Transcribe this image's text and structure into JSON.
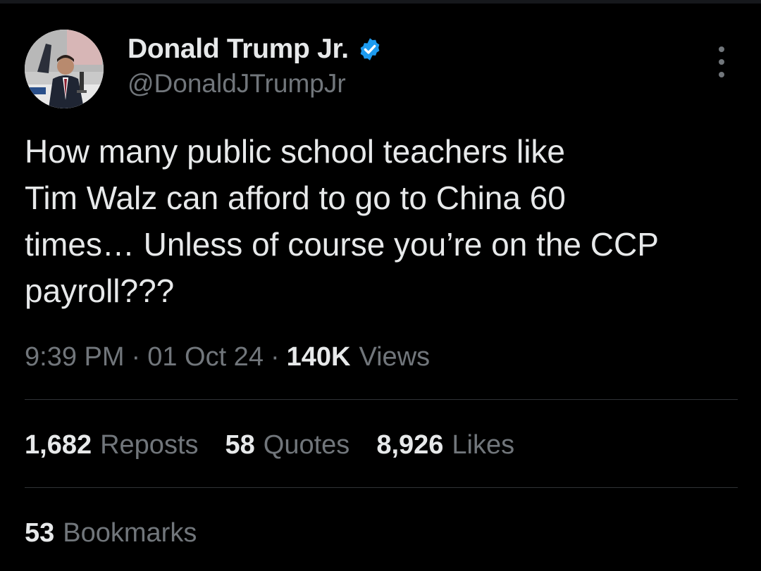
{
  "author": {
    "display_name": "Donald Trump Jr.",
    "handle": "@DonaldJTrumpJr",
    "verified_icon": "verified-badge-icon",
    "verified_color": "#1d9bf0"
  },
  "tweet": {
    "text_lines": [
      "How many public school teachers like",
      "Tim Walz can afford to go to China 60",
      "times… Unless of course you’re on the CCP",
      "payroll???"
    ],
    "time": "9:39 PM",
    "separator": "·",
    "date": "01 Oct 24",
    "views_count": "140K",
    "views_label": "Views"
  },
  "stats": {
    "reposts_count": "1,682",
    "reposts_label": "Reposts",
    "quotes_count": "58",
    "quotes_label": "Quotes",
    "likes_count": "8,926",
    "likes_label": "Likes",
    "bookmarks_count": "53",
    "bookmarks_label": "Bookmarks"
  },
  "colors": {
    "background": "#000000",
    "primary_text": "#e7e9ea",
    "secondary_text": "#71767b",
    "divider": "#2f3336"
  }
}
